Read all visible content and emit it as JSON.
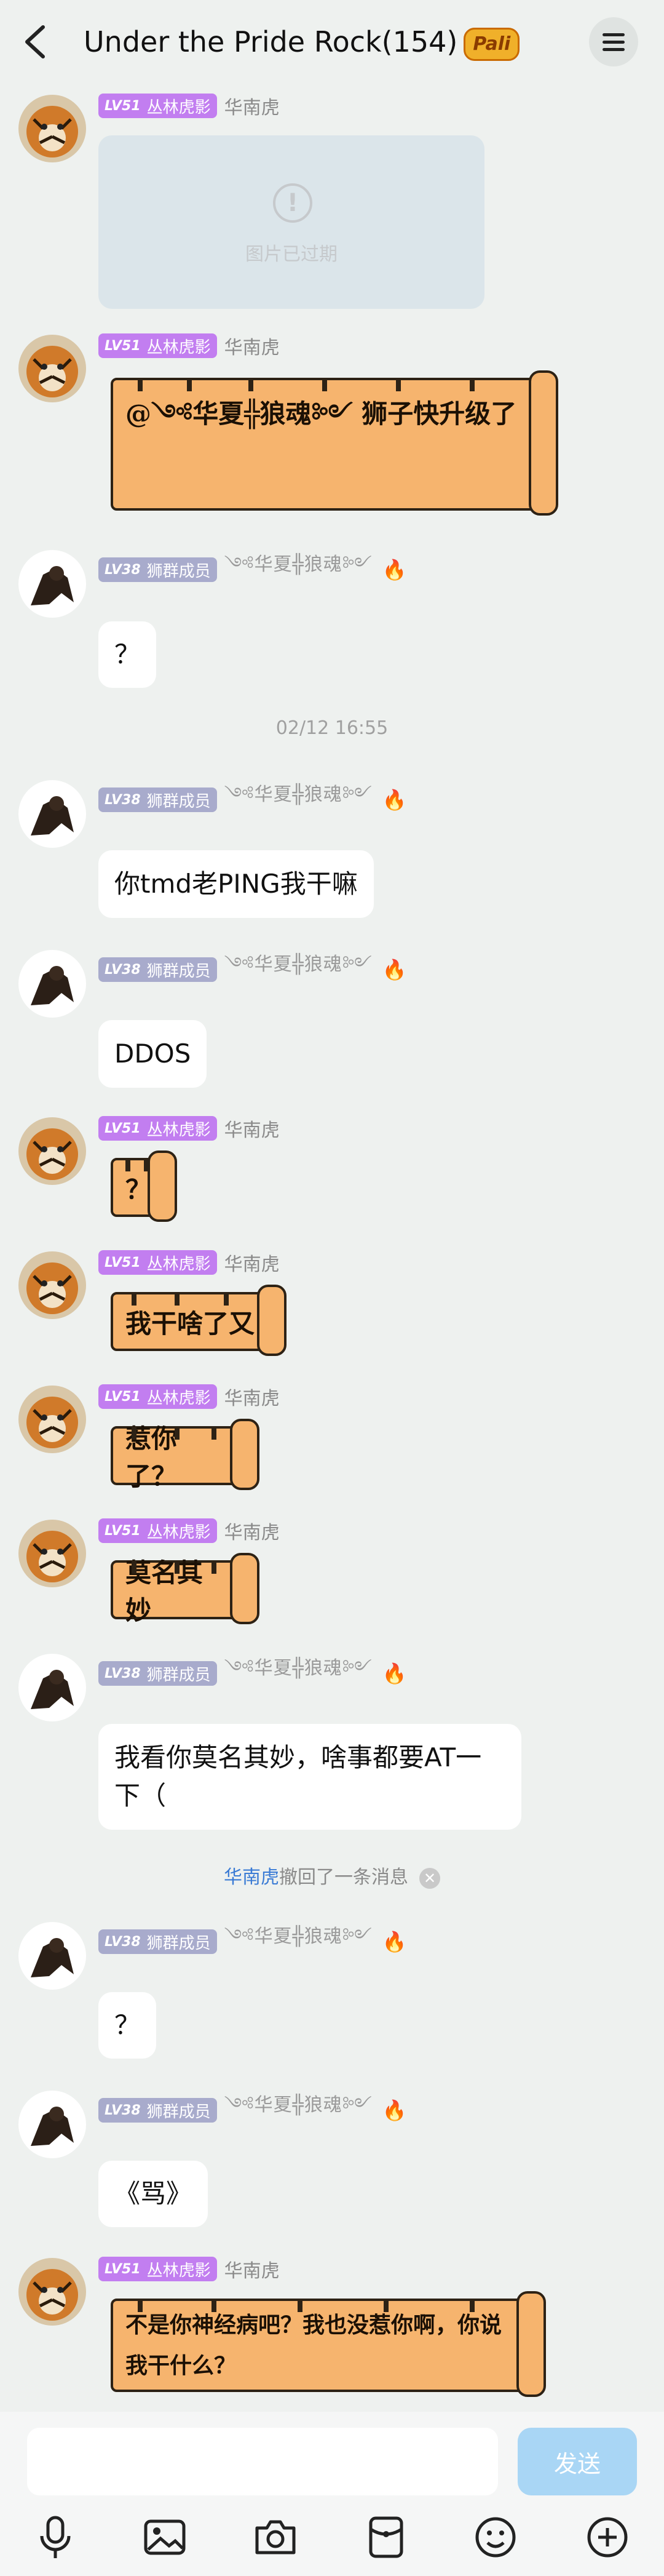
{
  "header": {
    "title": "Under the Pride Rock(154)",
    "badge": "Pali"
  },
  "expired_image": {
    "text": "图片已过期"
  },
  "users": {
    "tiger": {
      "level": "LV51",
      "title": "丛林虎影",
      "nickname": "华南虎"
    },
    "lion": {
      "level": "LV38",
      "title": "狮群成员",
      "nickname": "༺华夏╬狼魂༻"
    }
  },
  "messages": [
    {
      "text": "@༺华夏╬狼魂༻ 狮子快升级了"
    },
    {
      "text": "？"
    },
    {
      "text": "你tmd老PING我干嘛"
    },
    {
      "text": "DDOS"
    },
    {
      "text": "？"
    },
    {
      "text": "我干啥了又"
    },
    {
      "text": "惹你了？"
    },
    {
      "text": "莫名其妙"
    },
    {
      "text": "我看你莫名其妙，啥事都要AT一下（"
    },
    {
      "text": "？"
    },
    {
      "text": "《骂》"
    },
    {
      "text": "不是你神经病吧？我也没惹你啊，你说我干什么？"
    }
  ],
  "timestamp": "02/12 16:55",
  "recall": {
    "name": "华南虎",
    "text": "撤回了一条消息"
  },
  "composer": {
    "send_label": "发送"
  },
  "colors": {
    "tiger_badge": "#c27ef0",
    "lion_badge": "#a8abcc",
    "send_button": "#a9d6f5",
    "recall_name": "#3a7bd5"
  }
}
